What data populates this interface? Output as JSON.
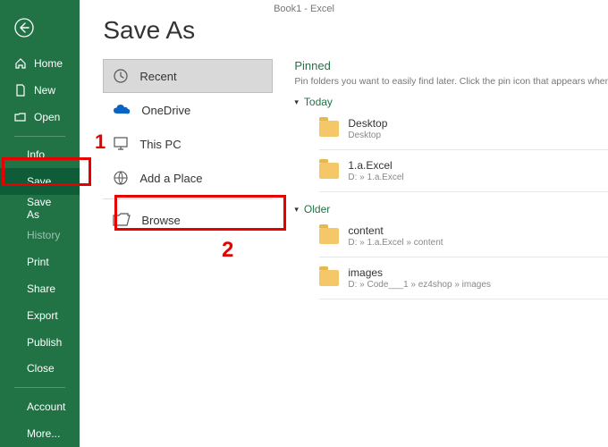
{
  "titlebar": "Book1 - Excel",
  "heading": "Save As",
  "sidebar": {
    "home": "Home",
    "new": "New",
    "open": "Open",
    "info": "Info",
    "save": "Save",
    "save_as": "Save As",
    "history": "History",
    "print": "Print",
    "share": "Share",
    "export": "Export",
    "publish": "Publish",
    "close": "Close",
    "account": "Account",
    "more": "More..."
  },
  "locations": {
    "recent": "Recent",
    "onedrive": "OneDrive",
    "this_pc": "This PC",
    "add_place": "Add a Place",
    "browse": "Browse"
  },
  "pinned": {
    "title": "Pinned",
    "help": "Pin folders you want to easily find later. Click the pin icon that appears when you",
    "groups": [
      {
        "label": "Today",
        "items": [
          {
            "name": "Desktop",
            "path": "Desktop"
          },
          {
            "name": "1.a.Excel",
            "path": "D: » 1.a.Excel"
          }
        ]
      },
      {
        "label": "Older",
        "items": [
          {
            "name": "content",
            "path": "D: » 1.a.Excel » content"
          },
          {
            "name": "images",
            "path": "D: » Code___1 » ez4shop » images"
          }
        ]
      }
    ]
  },
  "annotations": {
    "one": "1",
    "two": "2"
  }
}
